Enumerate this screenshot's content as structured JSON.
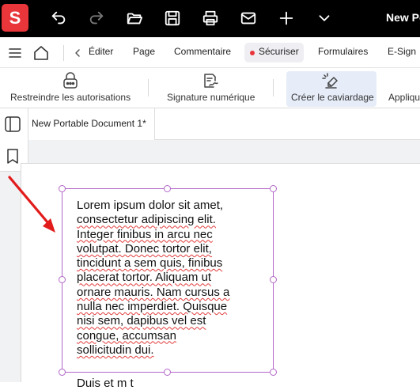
{
  "titlebar": {
    "logo_letter": "S",
    "doc_title": "New Po",
    "icons": [
      "undo-icon",
      "redo-icon",
      "folder-open-icon",
      "save-icon",
      "print-icon",
      "mail-icon",
      "plus-icon",
      "chevron-down-icon"
    ]
  },
  "menubar": {
    "items": [
      "Éditer",
      "Page",
      "Commentaire",
      "Sécuriser",
      "Formulaires",
      "E-Sign"
    ],
    "active": "Sécuriser"
  },
  "toolbar": {
    "tools": [
      "Restreindre les autorisations",
      "Signature numérique",
      "Créer le caviardage",
      "Appliqu"
    ],
    "active": "Créer le caviardage"
  },
  "tab": {
    "label": "New Portable Document 1*"
  },
  "document": {
    "textbox_lines": [
      "Lorem ipsum dolor sit amet,",
      "consectetur adipiscing elit.",
      "Integer finibus in arcu nec",
      "volutpat. Donec tortor elit,",
      "tincidunt a sem quis, finibus",
      "placerat tortor. Aliquam ut",
      "ornare mauris. Nam cursus a",
      "nulla nec imperdiet. Quisque",
      "nisi sem, dapibus vel est",
      "congue, accumsan",
      "sollicitudin dui."
    ],
    "below_text": "Duis  et  m  t"
  },
  "colors": {
    "accent": "#e8363b",
    "selection": "#b266c8",
    "active_tool_bg": "#e6ecf8"
  }
}
